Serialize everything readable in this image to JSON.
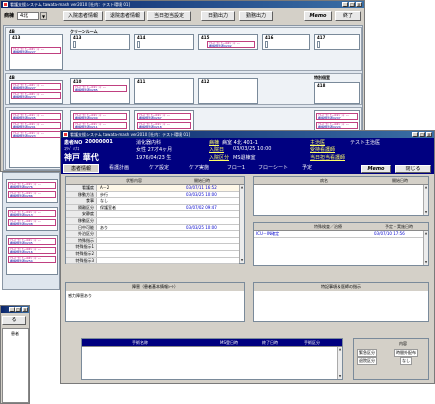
{
  "back_window": {
    "title": "看護支援システム  tawata-mash  ver2010  [社内：テスト環境  01]",
    "toolbar": {
      "ward_label": "病棟",
      "ward_value": "4北",
      "buttons": [
        "入院患者情報",
        "退院患者情報",
        "当日担当設定",
        "日勤出力",
        "勤務出力"
      ],
      "memo_label": "Memo",
      "end_label": "終了"
    },
    "wards": [
      {
        "code": "4B",
        "rooms": [
          {
            "no": "413",
            "beds": [
              {
                "line1": "ﾐﾔｰﾊﾞｸﾗﾞﾅｰｰ02ﾍﾞｯﾄﾞｰｰ",
                "line2": "看護師患者0227",
                "tag": "□"
              }
            ]
          },
          {
            "no": "414",
            "beds": []
          },
          {
            "no": "415",
            "beds": [
              {
                "line1": "ﾐﾔｰﾊﾞｸﾗﾞﾅｰｰ02ﾍﾞｯﾄﾞｰｰ",
                "line2": "看護師患者0202",
                "tag": "□"
              }
            ]
          },
          {
            "no": "416",
            "beds": []
          },
          {
            "no": "417",
            "beds": []
          }
        ],
        "header": "クリーンルーム"
      },
      {
        "code": "4B",
        "rooms": [
          {
            "no": "410",
            "beds": [
              {
                "line1": "ﾐﾔｰﾊﾞｸﾗﾞﾅｰｰ01ﾍﾞｯﾄﾞｰｰ",
                "line2": "看護師患者0285",
                "tag": "□"
              }
            ]
          },
          {
            "no": "411",
            "beds": []
          },
          {
            "no": "412",
            "beds": []
          },
          {
            "no": "418",
            "beds": []
          }
        ],
        "header": "特別個室"
      }
    ],
    "left_bed_sets": [
      [
        {
          "line1": "ﾐﾔｰﾊﾞｸﾗﾞﾅｰｰ02ﾍﾞｯﾄﾞｰｰ",
          "line2": "看護師患者0227",
          "tag": "□"
        },
        {
          "line1": "ﾐﾔｰﾊﾞｸﾗﾞﾅｰｰ02ﾍﾞｯﾄﾞｰｰ",
          "line2": "看護師患者0273",
          "tag": "□"
        }
      ],
      [
        {
          "line1": "ﾐﾔｰﾊﾞｸﾗﾞﾅｰｰ01ﾍﾞｯﾄﾞｰｰ",
          "line2": "看護師患者0205",
          "tag": "□"
        },
        {
          "line1": "ﾐﾔｰﾊﾞｸﾗﾞﾅｰｰ01ﾍﾞｯﾄﾞｰｰ",
          "line2": "看護師患者0276",
          "tag": "□"
        }
      ],
      [
        {
          "line1": "ﾐﾔｰﾊﾞｸﾗﾞﾅｰｰ01ﾍﾞｯﾄﾞｰｰ",
          "line2": "看護師患者0201",
          "tag": "□"
        },
        {
          "line1": "ﾐﾔｰﾊﾞｸﾗﾞﾅｰｰ01ﾍﾞｯﾄﾞｰｰ",
          "line2": "看護師患者0286",
          "tag": "□"
        }
      ],
      [
        {
          "line1": "ﾐﾔｰﾊﾞｸﾗﾞﾅｰｰ01ﾍﾞｯﾄﾞｰｰ",
          "line2": "看護師患者0223",
          "tag": "□"
        },
        {
          "line1": "ﾐﾔｰﾊﾞｸﾗﾞﾅｰｰ01ﾍﾞｯﾄﾞｰｰ",
          "line2": "看護師患者0213",
          "tag": "□"
        }
      ],
      [
        {
          "line1": "ﾐﾔｰﾊﾞｸﾗﾞﾅｰｰ02ﾍﾞｯﾄﾞｰｰ",
          "line2": "看護師患者0208",
          "tag": "□"
        },
        {
          "line1": "ﾐﾔｰﾊﾞｸﾗﾞﾅｰｰ02ﾍﾞｯﾄﾞｰｰ",
          "line2": "看護師患者0205",
          "tag": "□"
        }
      ],
      [
        {
          "line1": "ﾐﾔｰﾊﾞｸﾗﾞﾅｰｰ02ﾍﾞｯﾄﾞｰｰ",
          "line2": "看護師患者0216",
          "tag": "□"
        },
        {
          "line1": "ﾐﾔｰﾊﾞｸﾗﾞﾅｰｰ02ﾍﾞｯﾄﾞｰｰ",
          "line2": "看護師患者0254",
          "tag": "□"
        }
      ]
    ],
    "mid_bed_groups": [
      [
        {
          "line1": "ﾐﾔｰﾊﾞｸﾗﾞﾅｰｰ01ﾍﾞｯﾄﾞｰｰ",
          "line2": "看護師患者0200"
        },
        {
          "line1": "ﾐﾔｰﾊﾞｸﾗﾞﾅｰｰ01ﾍﾞｯﾄﾞｰｰ",
          "line2": "看護師患者0211"
        }
      ],
      [
        {
          "line1": "ﾐﾔｰﾊﾞｸﾗﾞﾅｰｰ01ﾍﾞｯﾄﾞｰｰ",
          "line2": "看護師患者0267"
        },
        {
          "line1": "ﾐﾔｰﾊﾞｸﾗﾞﾅｰｰ01ﾍﾞｯﾄﾞｰｰ",
          "line2": "看護師患者0218"
        }
      ]
    ],
    "right_beds": [
      {
        "line1": "ﾐﾔｰﾊﾞｸﾗﾞﾅｰｰ01ﾍﾞｯﾄﾞｰｰ",
        "line2": "看護師患者0207"
      },
      {
        "line1": "ﾐﾔｰﾊﾞｸﾗﾞﾅｰｰ02ﾍﾞｯﾄﾞｰｰ",
        "line2": "看護師患者0224"
      }
    ]
  },
  "small_window": {
    "tab_label": "る",
    "field_label": "患者"
  },
  "front_window": {
    "title": "看護支援システム  tawata-mash  ver2010  [社内：テスト環境  01]",
    "patient": {
      "id_label": "患者NO",
      "id_value": "20000001",
      "dept": "消化器内科",
      "kana": "ｺｳﾍﾞ ﾊﾅｺ",
      "sex_age": "女性  27才4ヶ月",
      "name": "神戸  華代",
      "dob": "1976/04/23 生",
      "ward_label": "病棟",
      "ward_value": "病室  4北 401-1",
      "admit_label": "入院日",
      "admit_value": "03/03/25 10:00",
      "dept2_label": "入院区分",
      "dept2_value": "MS退棟室",
      "doctor_label": "主治医",
      "doctor_value": "テスト主治医",
      "nurse_label": "受持看護師",
      "day_label": "当日担当看護師"
    },
    "tabs": [
      "患者情報",
      "看護計画",
      "ケア設定",
      "ケア実施",
      "フロー1",
      "フローシート",
      "予定"
    ],
    "memo_label": "Memo",
    "close_label": "閉じる",
    "info_panel": {
      "col1": "状態内容",
      "col2": "開始日時",
      "rows": [
        {
          "label": "看護度",
          "value": "A－2",
          "date": "03/07/11 16:52"
        },
        {
          "label": "移動方法",
          "value": "歩行",
          "date": "03/03/25 10:00"
        },
        {
          "label": "食事",
          "value": "なし",
          "date": ""
        },
        {
          "label": "隔離区分",
          "value": "保護室者",
          "date": "03/07/02 09:47"
        },
        {
          "label": "安静度",
          "value": "",
          "date": ""
        },
        {
          "label": "移動区分",
          "value": "",
          "date": ""
        },
        {
          "label": "日中可能",
          "value": "あり",
          "date": "03/03/25 10:00"
        },
        {
          "label": "外泊区分",
          "value": "",
          "date": ""
        },
        {
          "label": "特殊指示",
          "value": "",
          "date": ""
        },
        {
          "label": "特殊指示1",
          "value": "",
          "date": ""
        },
        {
          "label": "特殊指示2",
          "value": "",
          "date": ""
        },
        {
          "label": "特殊指示3",
          "value": "",
          "date": ""
        }
      ]
    },
    "disease_panel": {
      "col1": "病名",
      "col2": "開始日時"
    },
    "treatment_panel": {
      "title": "特殊検査／治療",
      "col2": "予定・実施日時",
      "rows": [
        {
          "name": "ICU－IN確定",
          "date": "03/07/10 17:56"
        }
      ]
    },
    "allergy_panel": {
      "title": "障害（患者基本情報ｼｰﾄ）",
      "rows": [
        "感力障害あり"
      ]
    },
    "notes_panel": {
      "title": "特記事項＆医師の指示"
    },
    "procedure_panel": {
      "col1": "手術名称",
      "col2": "MS登日時",
      "col3": "終了日時",
      "col4": "手術区分"
    },
    "status_panel": {
      "header": "内容",
      "rows": [
        {
          "label": "緊急区分",
          "value": "時間外配布"
        },
        {
          "label": "退院区分",
          "value": "なし"
        }
      ]
    }
  }
}
